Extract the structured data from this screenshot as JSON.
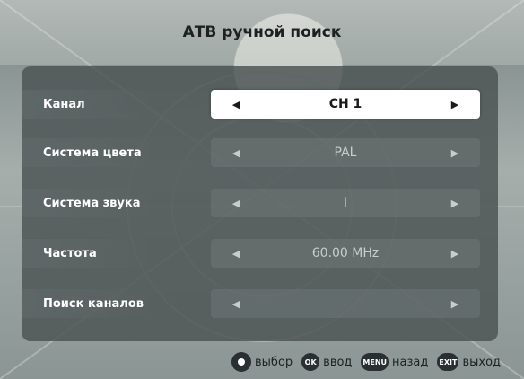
{
  "header": {
    "title": "АТВ ручной поиск"
  },
  "rows": [
    {
      "label": "Канал",
      "value": "CH 1",
      "active": true
    },
    {
      "label": "Система цвета",
      "value": "PAL",
      "active": false
    },
    {
      "label": "Система звука",
      "value": "I",
      "active": false
    },
    {
      "label": "Частота",
      "value": "60.00 MHz",
      "active": false
    },
    {
      "label": "Поиск каналов",
      "value": "",
      "active": false
    }
  ],
  "arrows": {
    "left": "◀",
    "right": "▶"
  },
  "hints": [
    {
      "key": "",
      "key_icon": "dpad-icon",
      "label": "выбор"
    },
    {
      "key": "OK",
      "key_icon": "ok-key-icon",
      "label": "ввод"
    },
    {
      "key": "MENU",
      "key_icon": "menu-key-icon",
      "label": "назад"
    },
    {
      "key": "EXIT",
      "key_icon": "exit-key-icon",
      "label": "выход"
    }
  ],
  "colors": {
    "panel": "#4a5252",
    "active_selector": "#ffffff",
    "label_text": "#ffffff"
  }
}
